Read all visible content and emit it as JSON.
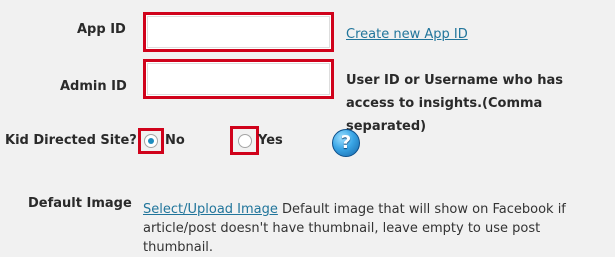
{
  "form": {
    "app_id": {
      "label": "App ID",
      "value": "",
      "link": "Create new App ID"
    },
    "admin_id": {
      "label": "Admin ID",
      "value": "",
      "hint": "User ID or Username who has access to insights.(Comma separated)"
    },
    "kid_directed": {
      "label": "Kid Directed Site?",
      "options": [
        "No",
        "Yes"
      ],
      "selected": "No",
      "help_icon": "question-mark-icon",
      "help_glyph": "?"
    },
    "default_image": {
      "label": "Default Image",
      "link": "Select/Upload Image",
      "description": "Default image that will show on Facebook if article/post doesn't have thumbnail, leave empty to use post thumbnail."
    }
  },
  "colors": {
    "highlight_border": "#d0021b",
    "link": "#21759b",
    "background": "#f1f1f1"
  }
}
